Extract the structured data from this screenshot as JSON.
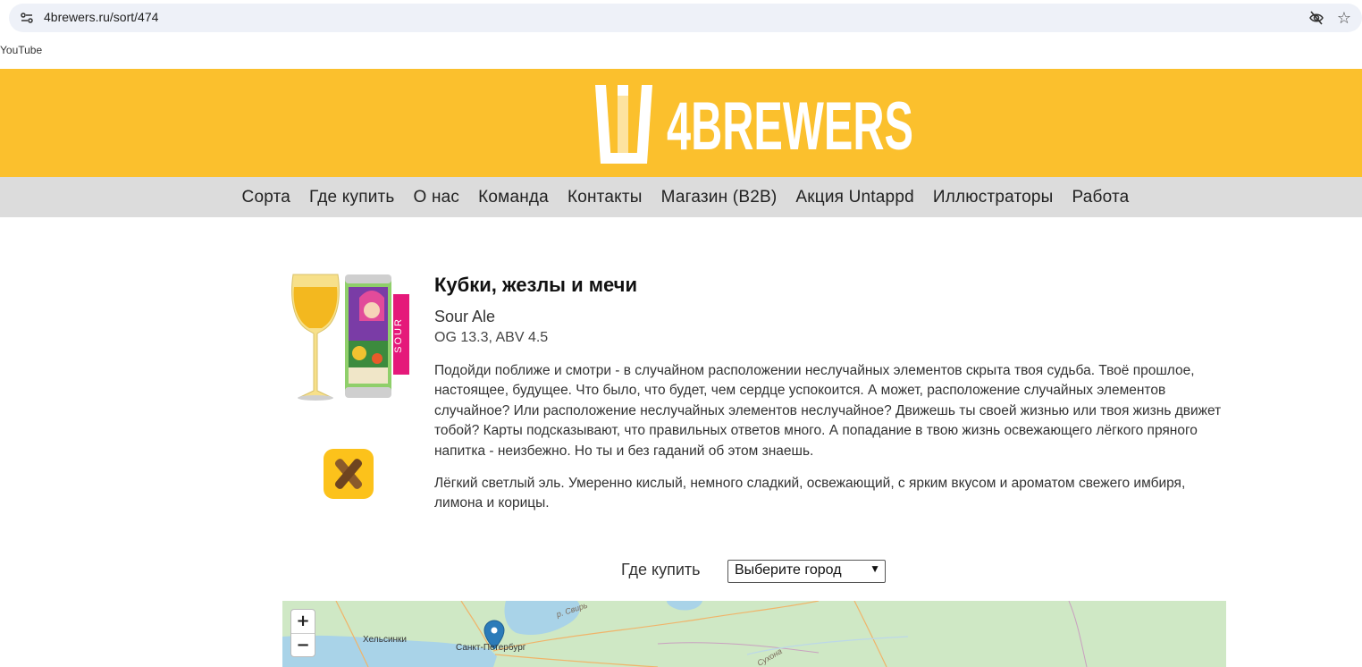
{
  "browser": {
    "url": "4brewers.ru/sort/474",
    "bookmark": "YouTube"
  },
  "site": {
    "logo_text": "4BREWERS",
    "nav": [
      "Сорта",
      "Где купить",
      "О нас",
      "Команда",
      "Контакты",
      "Магазин (B2B)",
      "Акция Untappd",
      "Иллюстраторы",
      "Работа"
    ]
  },
  "product": {
    "title": "Кубки, жезлы и мечи",
    "style": "Sour Ale",
    "og_abv": "OG 13.3, ABV 4.5",
    "can_label": "SOUR",
    "description": "Подойди поближе и смотри - в случайном расположении неслучайных элементов скрыта твоя судьба. Твоё прошлое, настоящее, будущее. Что было, что будет, чем сердце успокоится. А может, расположение случайных элементов случайное? Или расположение неслучайных элементов неслучайное? Движешь ты своей жизнью или твоя жизнь движет тобой? Карты подсказывают, что правильных ответов много. А попадание в твою жизнь освежающего лёгкого пряного напитка - неизбежно. Но ты и без гаданий об этом знаешь.",
    "summary": "Лёгкий светлый эль. Умеренно кислый, немного сладкий, освежающий, с ярким вкусом и ароматом свежего имбиря, лимона и корицы."
  },
  "buy": {
    "label": "Где купить",
    "select_value": "Выберите город"
  },
  "map": {
    "zoom_in": "+",
    "zoom_out": "−",
    "labels": {
      "helsinki": "Хельсинки",
      "spb": "Санкт-Петербург",
      "svir": "р. Свирь",
      "sukhona": "Сухона"
    }
  },
  "colors": {
    "header_yellow": "#fbc02d",
    "nav_gray": "#dcdcdc",
    "can_pink": "#e5197a"
  }
}
